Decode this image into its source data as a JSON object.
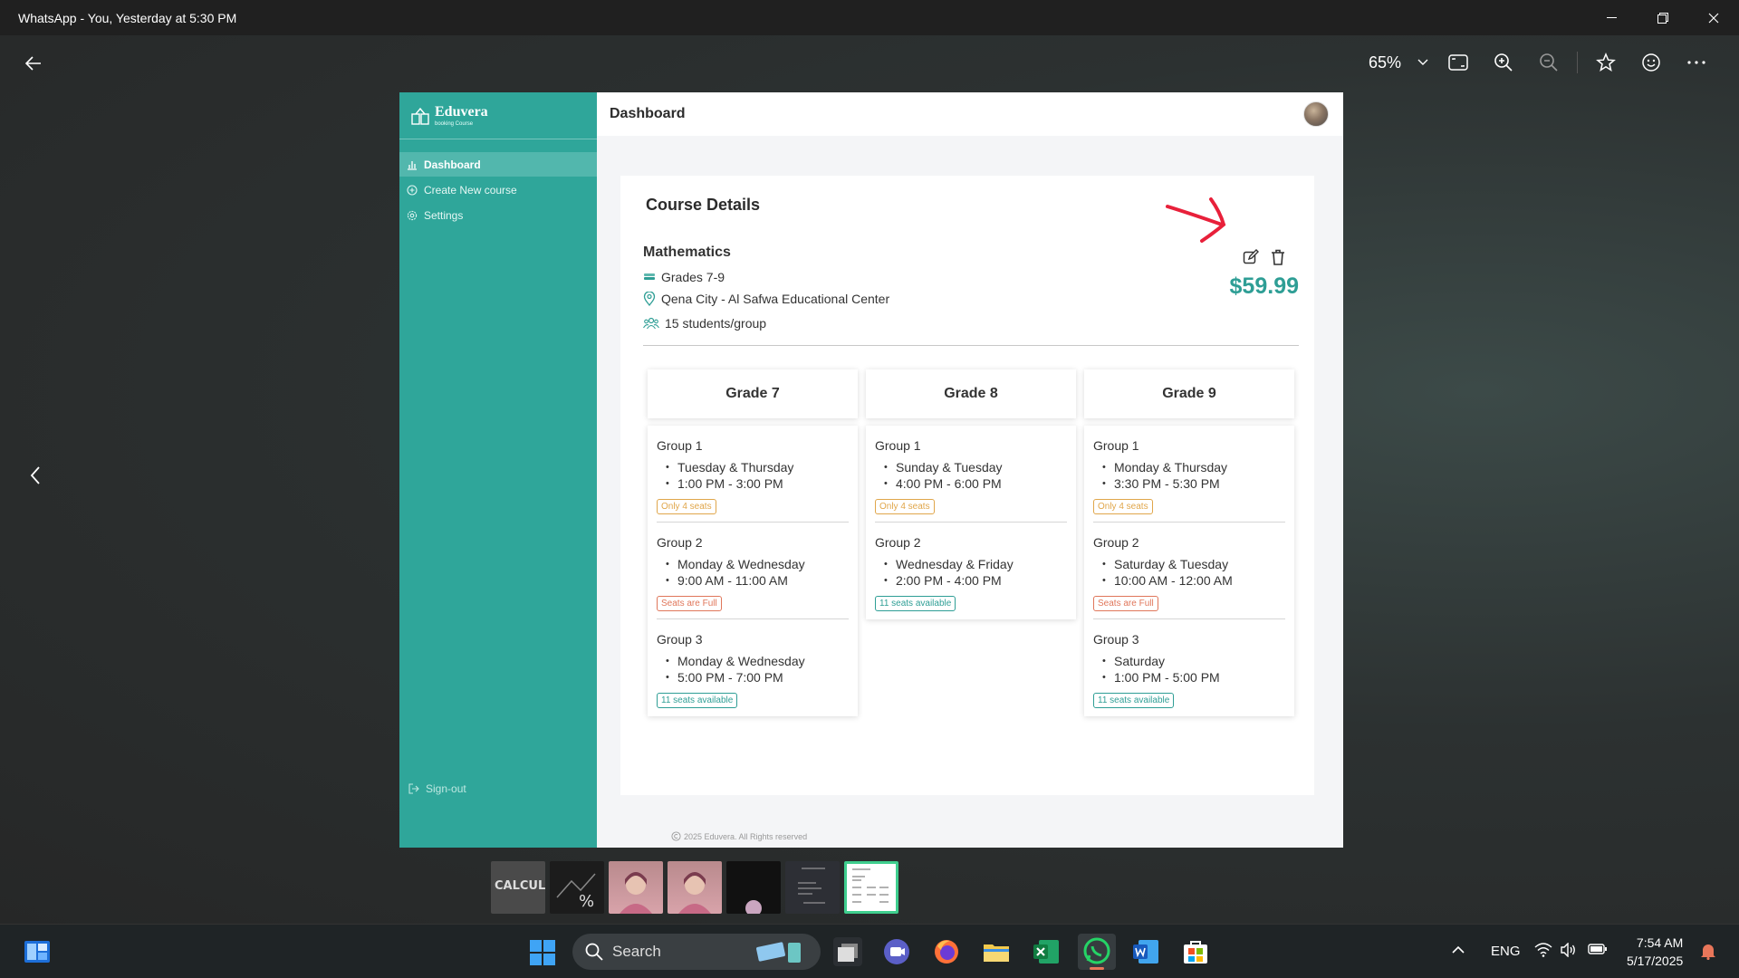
{
  "window": {
    "title": "WhatsApp - You, Yesterday at 5:30 PM"
  },
  "viewer": {
    "zoom": "65%"
  },
  "app": {
    "brand_name": "Eduvera",
    "brand_sub": "booking Course",
    "nav": [
      {
        "label": "Dashboard",
        "icon": "bar-chart-icon",
        "active": true
      },
      {
        "label": "Create New course",
        "icon": "plus-circle-icon",
        "active": false
      },
      {
        "label": "Settings",
        "icon": "gear-icon",
        "active": false
      }
    ],
    "signout": "Sign-out",
    "page_title": "Dashboard",
    "footer": "2025 Eduvera. All Rights reserved"
  },
  "course": {
    "section_title": "Course Details",
    "name": "Mathematics",
    "grades": "Grades 7-9",
    "location": "Qena City - Al Safwa Educational Center",
    "capacity": "15 students/group",
    "price": "$59.99"
  },
  "grades": [
    {
      "title": "Grade 7",
      "groups": [
        {
          "name": "Group 1",
          "days": "Tuesday & Thursday",
          "time": "1:00 PM - 3:00 PM",
          "status": "Only 4 seats",
          "status_color": "#e0a64a"
        },
        {
          "name": "Group 2",
          "days": "Monday & Wednesday",
          "time": "9:00 AM - 11:00 AM",
          "status": "Seats are Full",
          "status_color": "#e0765a"
        },
        {
          "name": "Group 3",
          "days": "Monday & Wednesday",
          "time": "5:00 PM - 7:00 PM",
          "status": "11 seats available",
          "status_color": "#2e9e95"
        }
      ]
    },
    {
      "title": "Grade 8",
      "groups": [
        {
          "name": "Group 1",
          "days": "Sunday & Tuesday",
          "time": "4:00 PM - 6:00 PM",
          "status": "Only 4 seats",
          "status_color": "#e0a64a"
        },
        {
          "name": "Group 2",
          "days": "Wednesday & Friday",
          "time": "2:00 PM - 4:00 PM",
          "status": "11 seats available",
          "status_color": "#2e9e95"
        }
      ]
    },
    {
      "title": "Grade 9",
      "groups": [
        {
          "name": "Group 1",
          "days": "Monday & Thursday",
          "time": "3:30 PM - 5:30 PM",
          "status": "Only 4 seats",
          "status_color": "#e0a64a"
        },
        {
          "name": "Group 2",
          "days": "Saturday & Tuesday",
          "time": "10:00 AM - 12:00 AM",
          "status": "Seats are Full",
          "status_color": "#e0765a"
        },
        {
          "name": "Group 3",
          "days": "Saturday",
          "time": "1:00 PM - 5:00 PM",
          "status": "11 seats available",
          "status_color": "#2e9e95"
        }
      ]
    }
  ],
  "thumbnails": [
    {
      "label": "CALCULA",
      "selected": false
    },
    {
      "label": "",
      "selected": false
    },
    {
      "label": "",
      "selected": false
    },
    {
      "label": "",
      "selected": false
    },
    {
      "label": "",
      "selected": false
    },
    {
      "label": "",
      "selected": false
    },
    {
      "label": "",
      "selected": true
    }
  ],
  "taskbar": {
    "search_placeholder": "Search",
    "language": "ENG",
    "time": "7:54 AM",
    "date": "5/17/2025"
  },
  "colors": {
    "accent": "#2fa69a",
    "price": "#2e9e95",
    "arrow": "#e8203a"
  }
}
